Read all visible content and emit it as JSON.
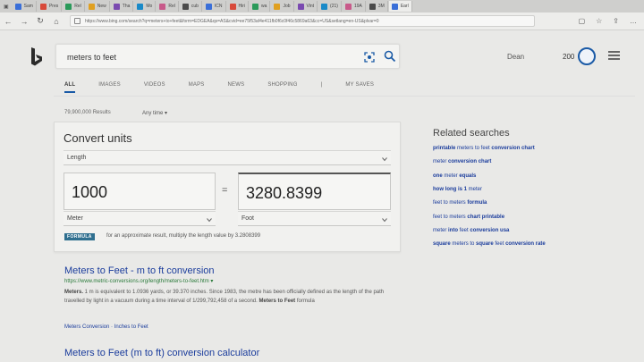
{
  "browser": {
    "tabs": [
      "Sam",
      "Pres",
      "Rel",
      "New",
      "Tha",
      "Mo",
      "Rel",
      "cub",
      "ICN",
      "Hiri",
      "wa",
      "Job",
      "Vint",
      "(21)",
      "19A",
      "3M",
      "Earl"
    ],
    "url": "https://www.bing.com/search?q=meters+to+feet&form=EDGEA&qs=AS&cvid=ee75f53af4e411fb0f6c0f46c5869a63&cc=US&setlang=en-US&plvar=0"
  },
  "search": {
    "query": "meters to feet",
    "user": "Dean",
    "points": "200"
  },
  "scopes": [
    "ALL",
    "IMAGES",
    "VIDEOS",
    "MAPS",
    "NEWS",
    "SHOPPING",
    "|",
    "MY SAVES"
  ],
  "results_meta": {
    "count": "79,900,000 Results",
    "time_filter": "Any time"
  },
  "converter": {
    "title": "Convert units",
    "category": "Length",
    "from_value": "1000",
    "to_value": "3280.8399",
    "from_unit": "Meter",
    "to_unit": "Foot",
    "equals": "=",
    "formula_badge": "FORMULA",
    "formula_text": "for an approximate result, multiply the length value by 3.2808399"
  },
  "results": [
    {
      "title": "Meters to Feet - m to ft conversion",
      "url": "https://www.metric-conversions.org/length/meters-to-feet.htm",
      "snippet_1": "Meters.",
      "snippet_2": " 1 m is equivalent to 1.0936 yards, or 39.370 inches. Since 1983, the metre has been officially defined as the length of the path travelled by light in a vacuum during a time interval of 1/299,792,458 of a second.",
      "snippet_3": "Meters to Feet",
      "snippet_4": " formula",
      "link_1": "Meters Conversion",
      "link_sep": " · ",
      "link_2": "Inches to Feet"
    },
    {
      "title": "Meters to Feet (m to ft) conversion calculator"
    }
  ],
  "related": {
    "heading": "Related searches",
    "items": [
      {
        "parts": [
          [
            "b",
            "printable"
          ],
          [
            "n",
            " meters to feet "
          ],
          [
            "b",
            "conversion chart"
          ]
        ]
      },
      {
        "parts": [
          [
            "n",
            "meter "
          ],
          [
            "b",
            "conversion chart"
          ]
        ]
      },
      {
        "parts": [
          [
            "b",
            "one"
          ],
          [
            "n",
            " meter "
          ],
          [
            "b",
            "equals"
          ]
        ]
      },
      {
        "parts": [
          [
            "b",
            "how long is 1"
          ],
          [
            "n",
            " meter"
          ]
        ]
      },
      {
        "parts": [
          [
            "n",
            "feet to meters "
          ],
          [
            "b",
            "formula"
          ]
        ]
      },
      {
        "parts": [
          [
            "n",
            "feet to meters "
          ],
          [
            "b",
            "chart printable"
          ]
        ]
      },
      {
        "parts": [
          [
            "n",
            "meter "
          ],
          [
            "b",
            "into"
          ],
          [
            "n",
            " feet "
          ],
          [
            "b",
            "conversion usa"
          ]
        ]
      },
      {
        "parts": [
          [
            "b",
            "square"
          ],
          [
            "n",
            " meters to "
          ],
          [
            "b",
            "square"
          ],
          [
            "n",
            " feet "
          ],
          [
            "b",
            "conversion rate"
          ]
        ]
      }
    ]
  },
  "colors": {
    "accent": "#1a5aa6",
    "link": "#1a3c9c",
    "url_green": "#2a7a3a",
    "badge": "#2f6f8f"
  }
}
